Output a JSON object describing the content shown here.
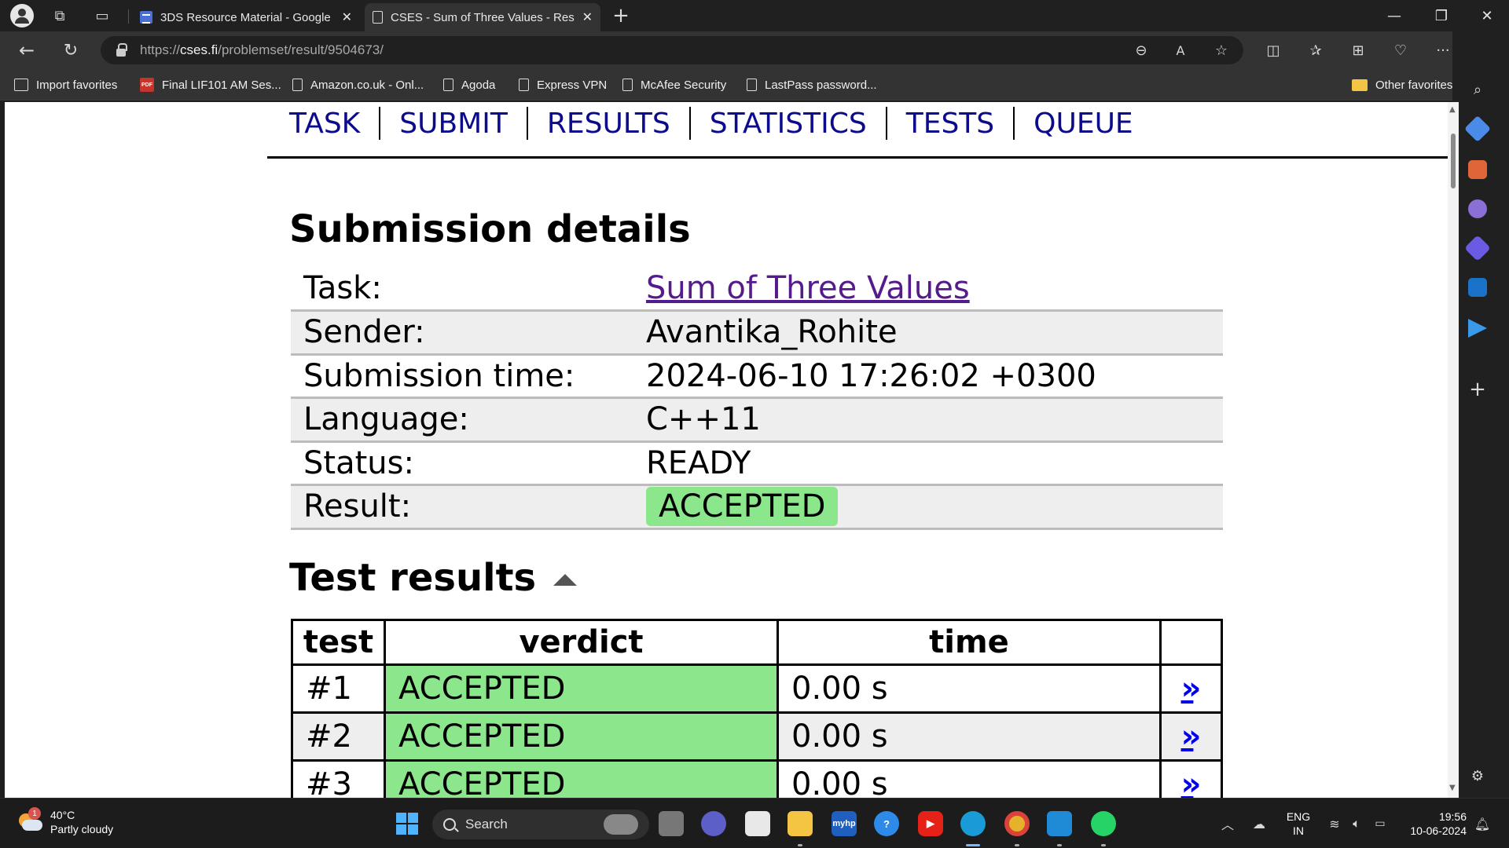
{
  "browser": {
    "tabs": [
      {
        "title": "3DS Resource Material - Google",
        "active": false
      },
      {
        "title": "CSES - Sum of Three Values - Res",
        "active": true
      }
    ],
    "url_scheme": "https://",
    "url_host": "cses.fi",
    "url_path": "/problemset/result/9504673/",
    "favorites": [
      {
        "label": "Import favorites",
        "icon": "import-icon"
      },
      {
        "label": "Final LIF101 AM Ses...",
        "icon": "pdf-icon"
      },
      {
        "label": "Amazon.co.uk - Onl...",
        "icon": "page-icon"
      },
      {
        "label": "Agoda",
        "icon": "page-icon"
      },
      {
        "label": "Express VPN",
        "icon": "page-icon"
      },
      {
        "label": "McAfee Security",
        "icon": "page-icon"
      },
      {
        "label": "LastPass password...",
        "icon": "page-icon"
      }
    ],
    "other_favorites": "Other favorites",
    "pdf_badge": "PDF"
  },
  "nav": {
    "links": [
      "TASK",
      "SUBMIT",
      "RESULTS",
      "STATISTICS",
      "TESTS",
      "QUEUE"
    ]
  },
  "submission": {
    "heading": "Submission details",
    "rows": [
      {
        "label": "Task:",
        "value": "Sum of Three Values",
        "link": true
      },
      {
        "label": "Sender:",
        "value": "Avantika_Rohite"
      },
      {
        "label": "Submission time:",
        "value": "2024-06-10 17:26:02 +0300"
      },
      {
        "label": "Language:",
        "value": "C++11"
      },
      {
        "label": "Status:",
        "value": "READY"
      },
      {
        "label": "Result:",
        "value": "ACCEPTED",
        "badge": true
      }
    ]
  },
  "tests": {
    "heading": "Test results",
    "columns": [
      "test",
      "verdict",
      "time",
      ""
    ],
    "rows": [
      {
        "test": "#1",
        "verdict": "ACCEPTED",
        "time": "0.00 s",
        "link": "»"
      },
      {
        "test": "#2",
        "verdict": "ACCEPTED",
        "time": "0.00 s",
        "link": "»"
      },
      {
        "test": "#3",
        "verdict": "ACCEPTED",
        "time": "0.00 s",
        "link": "»"
      }
    ]
  },
  "taskbar": {
    "weather_temp": "40°C",
    "weather_desc": "Partly cloudy",
    "weather_badge": "1",
    "search_placeholder": "Search",
    "lang_top": "ENG",
    "lang_bottom": "IN",
    "time": "19:56",
    "date": "10-06-2024",
    "myhp_label": "myhp"
  },
  "colors": {
    "accepted": "#8ce68c",
    "nav_link": "#0b0b8c",
    "visited_link": "#551a8b",
    "arrow_link": "#0000ee"
  }
}
